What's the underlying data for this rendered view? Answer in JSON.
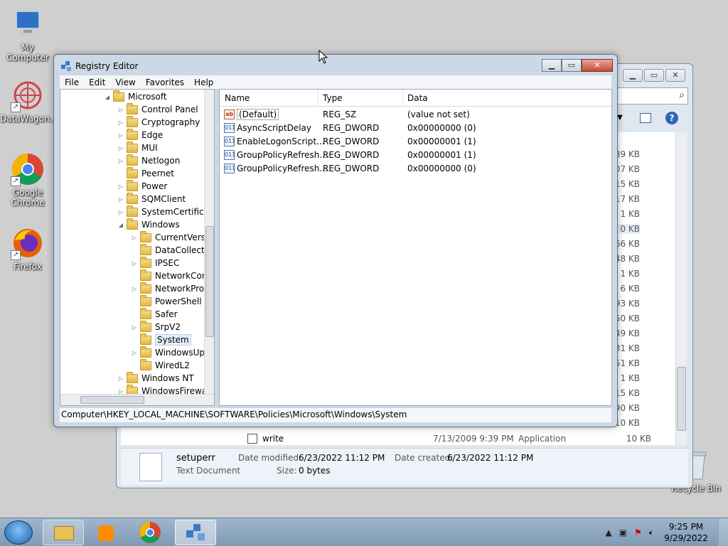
{
  "desktop": {
    "icons": [
      {
        "label": "My Computer"
      },
      {
        "label": "DataWagon..."
      },
      {
        "label": "Google Chrome"
      },
      {
        "label": "Firefox"
      }
    ],
    "recycle_label": "Recycle Bin"
  },
  "explorer": {
    "sizes": [
      "189 KB",
      "107 KB",
      "15 KB",
      "417 KB",
      "1 KB",
      "0 KB",
      "66 KB",
      "48 KB",
      "1 KB",
      "6 KB",
      "93 KB",
      "50 KB",
      "49 KB",
      "31 KB",
      "51 KB",
      "1 KB",
      "1,515 KB",
      "290 KB",
      "310 KB"
    ],
    "write_row": {
      "name": "write",
      "date": "7/13/2009 9:39 PM",
      "type": "Application",
      "size": "10 KB"
    },
    "details": {
      "name": "setuperr",
      "kind": "Text Document",
      "modified_label": "Date modified:",
      "modified": "6/23/2022 11:12 PM",
      "created_label": "Date created:",
      "created": "6/23/2022 11:12 PM",
      "size_label": "Size:",
      "size": "0 bytes"
    }
  },
  "regedit": {
    "title": "Registry Editor",
    "menu": [
      "File",
      "Edit",
      "View",
      "Favorites",
      "Help"
    ],
    "tree": [
      {
        "label": "Microsoft",
        "level": 0,
        "expander": "open"
      },
      {
        "label": "Control Panel",
        "level": 1,
        "expander": "closed"
      },
      {
        "label": "Cryptography",
        "level": 1,
        "expander": "closed"
      },
      {
        "label": "Edge",
        "level": 1,
        "expander": "closed"
      },
      {
        "label": "MUI",
        "level": 1,
        "expander": "closed"
      },
      {
        "label": "Netlogon",
        "level": 1,
        "expander": "closed"
      },
      {
        "label": "Peernet",
        "level": 1,
        "expander": "none"
      },
      {
        "label": "Power",
        "level": 1,
        "expander": "closed"
      },
      {
        "label": "SQMClient",
        "level": 1,
        "expander": "closed"
      },
      {
        "label": "SystemCertifica",
        "level": 1,
        "expander": "closed"
      },
      {
        "label": "Windows",
        "level": 1,
        "expander": "open"
      },
      {
        "label": "CurrentVersi",
        "level": 2,
        "expander": "closed"
      },
      {
        "label": "DataCollecti",
        "level": 2,
        "expander": "none"
      },
      {
        "label": "IPSEC",
        "level": 2,
        "expander": "closed"
      },
      {
        "label": "NetworkCor",
        "level": 2,
        "expander": "none"
      },
      {
        "label": "NetworkPro",
        "level": 2,
        "expander": "closed"
      },
      {
        "label": "PowerShell",
        "level": 2,
        "expander": "none"
      },
      {
        "label": "Safer",
        "level": 2,
        "expander": "none"
      },
      {
        "label": "SrpV2",
        "level": 2,
        "expander": "closed"
      },
      {
        "label": "System",
        "level": 2,
        "expander": "none",
        "selected": true
      },
      {
        "label": "WindowsUp",
        "level": 2,
        "expander": "closed"
      },
      {
        "label": "WiredL2",
        "level": 2,
        "expander": "none"
      },
      {
        "label": "Windows NT",
        "level": 1,
        "expander": "closed"
      },
      {
        "label": "WindowsFirewa",
        "level": 1,
        "expander": "closed"
      }
    ],
    "columns": [
      "Name",
      "Type",
      "Data"
    ],
    "values": [
      {
        "name": "(Default)",
        "type": "REG_SZ",
        "data": "(value not set)",
        "icon": "ab"
      },
      {
        "name": "AsyncScriptDelay",
        "type": "REG_DWORD",
        "data": "0x00000000 (0)",
        "icon": "011"
      },
      {
        "name": "EnableLogonScript...",
        "type": "REG_DWORD",
        "data": "0x00000001 (1)",
        "icon": "011"
      },
      {
        "name": "GroupPolicyRefresh...",
        "type": "REG_DWORD",
        "data": "0x00000001 (1)",
        "icon": "011"
      },
      {
        "name": "GroupPolicyRefresh...",
        "type": "REG_DWORD",
        "data": "0x00000000 (0)",
        "icon": "011"
      }
    ],
    "status_path": "Computer\\HKEY_LOCAL_MACHINE\\SOFTWARE\\Policies\\Microsoft\\Windows\\System"
  },
  "taskbar": {
    "time": "9:25 PM",
    "date": "9/29/2022"
  }
}
